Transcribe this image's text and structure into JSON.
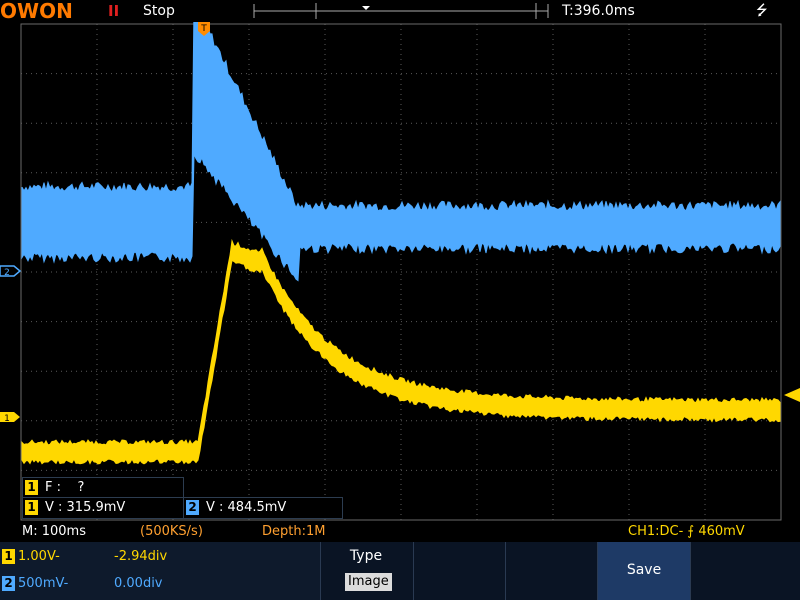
{
  "header": {
    "brand": "OWON",
    "run_icon": "pause-icon",
    "run_glyph": "II",
    "run_status": "Stop",
    "trigger_marker": "T",
    "trigger_time": "T:396.0ms",
    "usb_glyph": "⭍"
  },
  "markers": {
    "ch1_label": "1",
    "ch2_label": "2"
  },
  "measurements": {
    "freq_channel": "1",
    "freq_text": "F :    ?",
    "v1_channel": "1",
    "v1_text": "V : 315.9mV",
    "v2_channel": "2",
    "v2_text": "V : 484.5mV"
  },
  "status": {
    "timebase": "M: 100ms",
    "sample_rate": "(500KS/s)",
    "depth": "Depth:1M",
    "trigger": "CH1:DC- ⨍ 460mV"
  },
  "channels": [
    {
      "id": "1",
      "scale": "1.00V-",
      "offset": "-2.94div",
      "color": "#ffd800"
    },
    {
      "id": "2",
      "scale": "500mV-",
      "offset": "0.00div",
      "color": "#4faaff"
    }
  ],
  "menu": {
    "type_label": "Type",
    "type_value": "Image",
    "save_label": "Save"
  },
  "colors": {
    "ch1": "#ffd800",
    "ch2": "#4faaff",
    "brand": "#ff7a00",
    "grid": "#5a5a5a"
  }
}
